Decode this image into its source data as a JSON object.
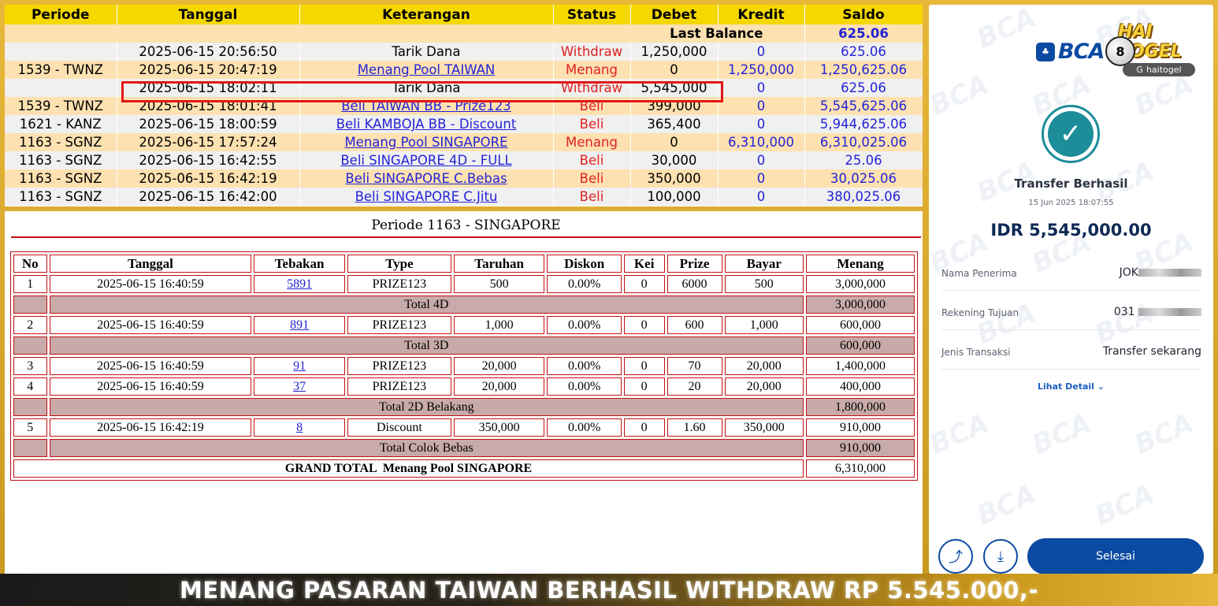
{
  "ledger": {
    "headers": [
      "Periode",
      "Tanggal",
      "Keterangan",
      "Status",
      "Debet",
      "Kredit",
      "Saldo"
    ],
    "last_balance_label": "Last Balance",
    "last_balance_value": "625.06",
    "rows": [
      {
        "periode": "",
        "tanggal": "2025-06-15 20:56:50",
        "keterangan": "Tarik Dana",
        "status": "Withdraw",
        "debet": "1,250,000",
        "kredit": "0",
        "saldo": "625.06"
      },
      {
        "periode": "1539 - TWNZ",
        "tanggal": "2025-06-15 20:47:19",
        "keterangan": "Menang Pool TAIWAN",
        "status": "Menang",
        "debet": "0",
        "kredit": "1,250,000",
        "saldo": "1,250,625.06"
      },
      {
        "periode": "",
        "tanggal": "2025-06-15 18:02:11",
        "keterangan": "Tarik Dana",
        "status": "Withdraw",
        "debet": "5,545,000",
        "kredit": "0",
        "saldo": "625.06"
      },
      {
        "periode": "1539 - TWNZ",
        "tanggal": "2025-06-15 18:01:41",
        "keterangan": "Beli TAIWAN BB - Prize123",
        "status": "Beli",
        "debet": "399,000",
        "kredit": "0",
        "saldo": "5,545,625.06"
      },
      {
        "periode": "1621 - KANZ",
        "tanggal": "2025-06-15 18:00:59",
        "keterangan": "Beli KAMBOJA BB - Discount",
        "status": "Beli",
        "debet": "365,400",
        "kredit": "0",
        "saldo": "5,944,625.06"
      },
      {
        "periode": "1163 - SGNZ",
        "tanggal": "2025-06-15 17:57:24",
        "keterangan": "Menang Pool SINGAPORE",
        "status": "Menang",
        "debet": "0",
        "kredit": "6,310,000",
        "saldo": "6,310,025.06"
      },
      {
        "periode": "1163 - SGNZ",
        "tanggal": "2025-06-15 16:42:55",
        "keterangan": "Beli SINGAPORE 4D - FULL",
        "status": "Beli",
        "debet": "30,000",
        "kredit": "0",
        "saldo": "25.06"
      },
      {
        "periode": "1163 - SGNZ",
        "tanggal": "2025-06-15 16:42:19",
        "keterangan": "Beli SINGAPORE C.Bebas",
        "status": "Beli",
        "debet": "350,000",
        "kredit": "0",
        "saldo": "30,025.06"
      },
      {
        "periode": "1163 - SGNZ",
        "tanggal": "2025-06-15 16:42:00",
        "keterangan": "Beli SINGAPORE C.Jitu",
        "status": "Beli",
        "debet": "100,000",
        "kredit": "0",
        "saldo": "380,025.06"
      }
    ]
  },
  "detail": {
    "title": "Periode 1163 - SINGAPORE",
    "headers": [
      "No",
      "Tanggal",
      "Tebakan",
      "Type",
      "Taruhan",
      "Diskon",
      "Kei",
      "Prize",
      "Bayar",
      "Menang"
    ],
    "bets": [
      {
        "no": "1",
        "tanggal": "2025-06-15 16:40:59",
        "tebakan": "5891",
        "type": "PRIZE123",
        "taruhan": "500",
        "diskon": "0.00%",
        "kei": "0",
        "prize": "6000",
        "bayar": "500",
        "menang": "3,000,000"
      },
      {
        "no": "2",
        "tanggal": "2025-06-15 16:40:59",
        "tebakan": "891",
        "type": "PRIZE123",
        "taruhan": "1,000",
        "diskon": "0.00%",
        "kei": "0",
        "prize": "600",
        "bayar": "1,000",
        "menang": "600,000"
      },
      {
        "no": "3",
        "tanggal": "2025-06-15 16:40:59",
        "tebakan": "91",
        "type": "PRIZE123",
        "taruhan": "20,000",
        "diskon": "0.00%",
        "kei": "0",
        "prize": "70",
        "bayar": "20,000",
        "menang": "1,400,000"
      },
      {
        "no": "4",
        "tanggal": "2025-06-15 16:40:59",
        "tebakan": "37",
        "type": "PRIZE123",
        "taruhan": "20,000",
        "diskon": "0.00%",
        "kei": "0",
        "prize": "20",
        "bayar": "20,000",
        "menang": "400,000"
      },
      {
        "no": "5",
        "tanggal": "2025-06-15 16:42:19",
        "tebakan": "8",
        "type": "Discount",
        "taruhan": "350,000",
        "diskon": "0.00%",
        "kei": "0",
        "prize": "1.60",
        "bayar": "350,000",
        "menang": "910,000"
      }
    ],
    "totals": [
      {
        "label": "Total 4D",
        "value": "3,000,000"
      },
      {
        "label": "Total 3D",
        "value": "600,000"
      },
      {
        "label": "Total 2D Belakang",
        "value": "1,800,000"
      },
      {
        "label": "Total Colok Bebas",
        "value": "910,000"
      }
    ],
    "grand_label": "GRAND TOTAL  Menang Pool SINGAPORE",
    "grand_value": "6,310,000"
  },
  "receipt": {
    "bank": "BCA",
    "brand": "HAI TOGEL",
    "brand_tag": "haitogel",
    "watermark": "BCA",
    "title": "Transfer Berhasil",
    "datetime": "15 Jun 2025 18:07:55",
    "amount": "IDR 5,545,000.00",
    "fields": [
      {
        "label": "Nama Penerima",
        "value": "JOK"
      },
      {
        "label": "Rekening Tujuan",
        "value": "031"
      },
      {
        "label": "Jenis Transaksi",
        "value": "Transfer sekarang"
      }
    ],
    "detail_link": "Lihat Detail",
    "done_button": "Selesai",
    "icons": [
      "share-icon",
      "download-icon",
      "check-icon",
      "chevron-down-icon"
    ],
    "colors": {
      "bca_blue": "#0b4aa2",
      "success_teal": "#1e8d9a"
    }
  },
  "caption": "MENANG PASARAN TAIWAN BERHASIL WITHDRAW RP 5.545.000,-"
}
